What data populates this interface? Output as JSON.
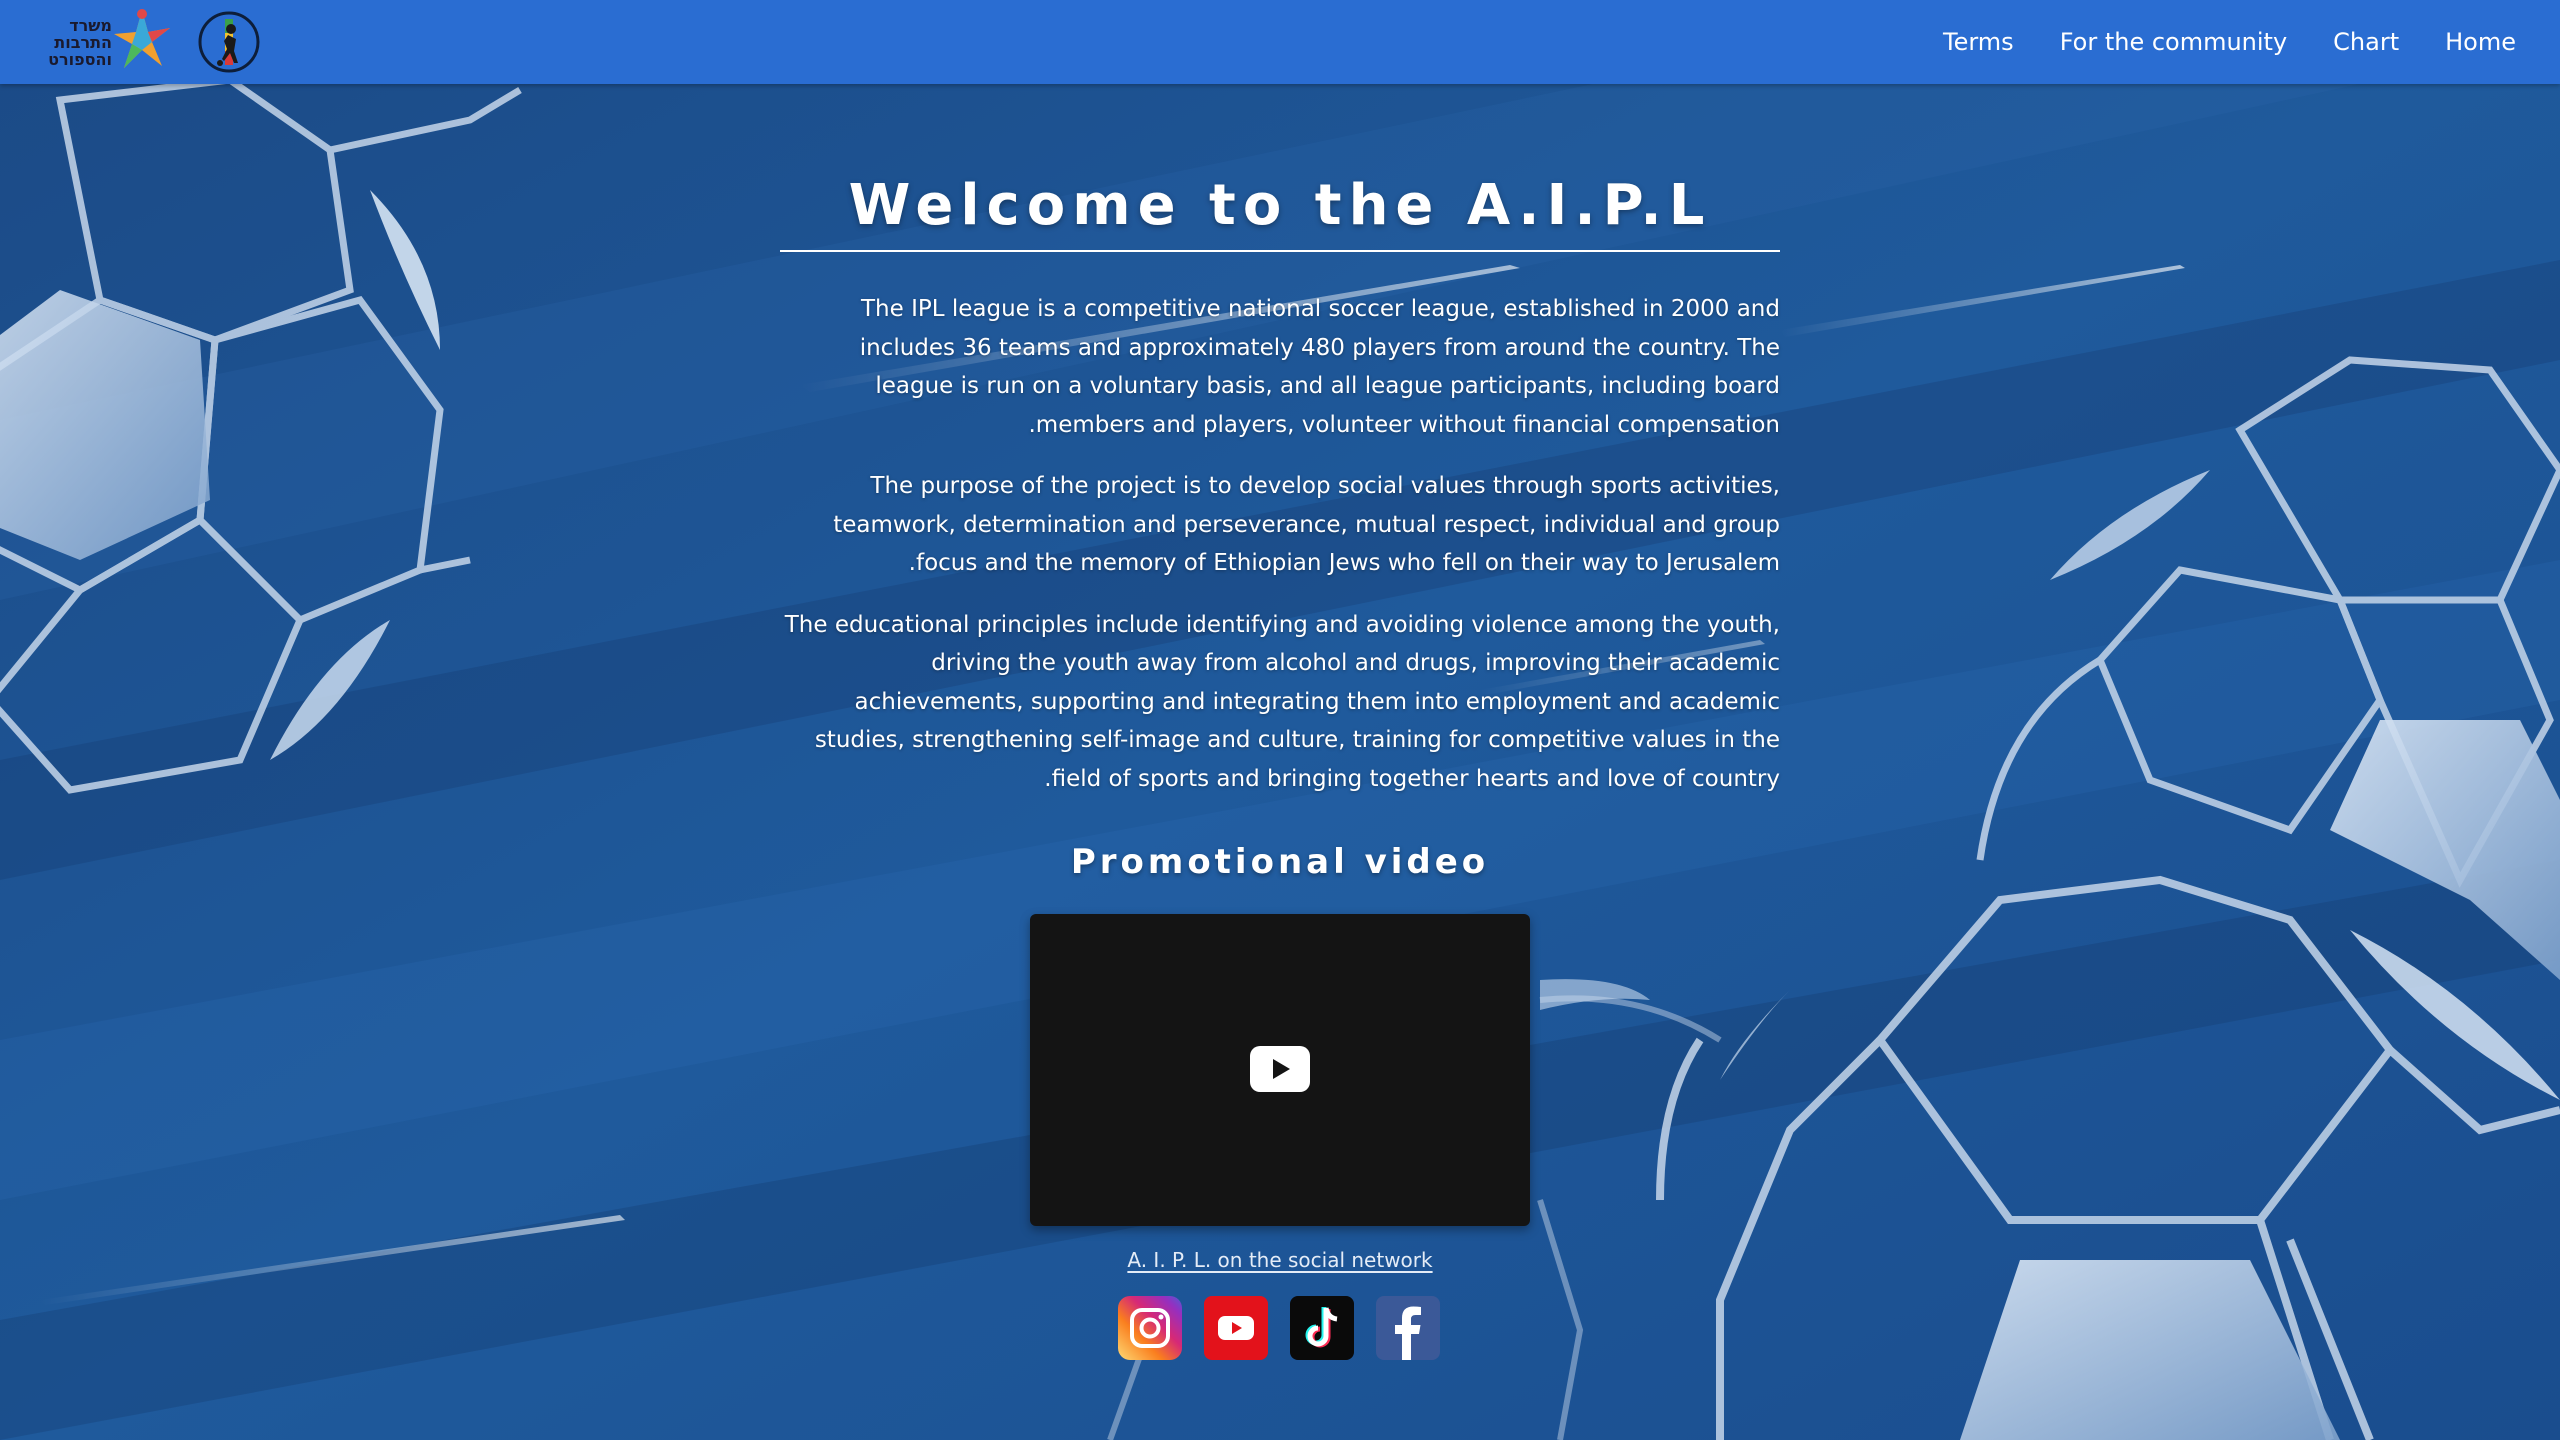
{
  "header": {
    "ministry_logo_text": "משרד\nהתרבות\nוהספורט",
    "nav": [
      "Terms",
      "For the community",
      "Chart",
      "Home"
    ]
  },
  "main": {
    "title": "Welcome to the A.I.P.L",
    "paragraphs": [
      "The IPL league is a competitive national soccer league, established in 2000 and includes 36 teams and approximately 480 players from around the country. The league is run on a voluntary basis, and all league participants, including board .members and players, volunteer without financial compensation",
      "The purpose of the project is to develop social values through sports activities, teamwork, determination and perseverance, mutual respect, individual and group .focus and the memory of Ethiopian Jews who fell on their way to Jerusalem",
      "The educational principles include identifying and avoiding violence among the youth, driving the youth away from alcohol and drugs, improving their academic achievements, supporting and integrating them into employment and academic studies, strengthening self-image and culture, training for competitive values in the .field of sports and bringing together hearts and love of country"
    ],
    "video_heading": "Promotional video"
  },
  "social": {
    "caption": "A. I. P. L. on the social network",
    "icons": [
      "instagram-icon",
      "youtube-icon",
      "tiktok-icon",
      "facebook-icon"
    ]
  },
  "colors": {
    "navbar": "#2a6dd2",
    "background": "#1d4f8c",
    "text": "#ffffff"
  }
}
